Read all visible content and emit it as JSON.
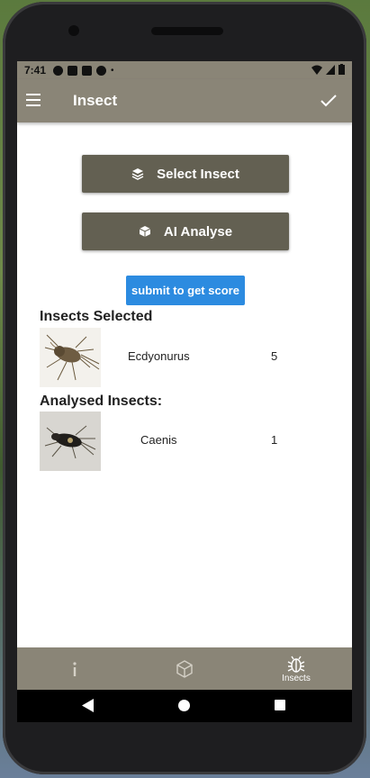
{
  "status": {
    "time": "7:41"
  },
  "appbar": {
    "title": "Insect"
  },
  "buttons": {
    "select_insect": "Select Insect",
    "ai_analyse": "AI Analyse",
    "submit": "submit to get score"
  },
  "selected": {
    "heading": "Insects Selected",
    "items": [
      {
        "name": "Ecdyonurus",
        "count": "5"
      }
    ]
  },
  "analysed": {
    "heading": "Analysed Insects:",
    "items": [
      {
        "name": "Caenis",
        "count": "1"
      }
    ]
  },
  "bottom_nav": {
    "items": [
      {
        "label": "",
        "icon": "info-icon"
      },
      {
        "label": "",
        "icon": "cube-icon"
      },
      {
        "label": "Insects",
        "icon": "bug-icon"
      }
    ]
  },
  "colors": {
    "appbar": "#8a8577",
    "button_dark": "#636052",
    "button_blue": "#2c8be0"
  }
}
